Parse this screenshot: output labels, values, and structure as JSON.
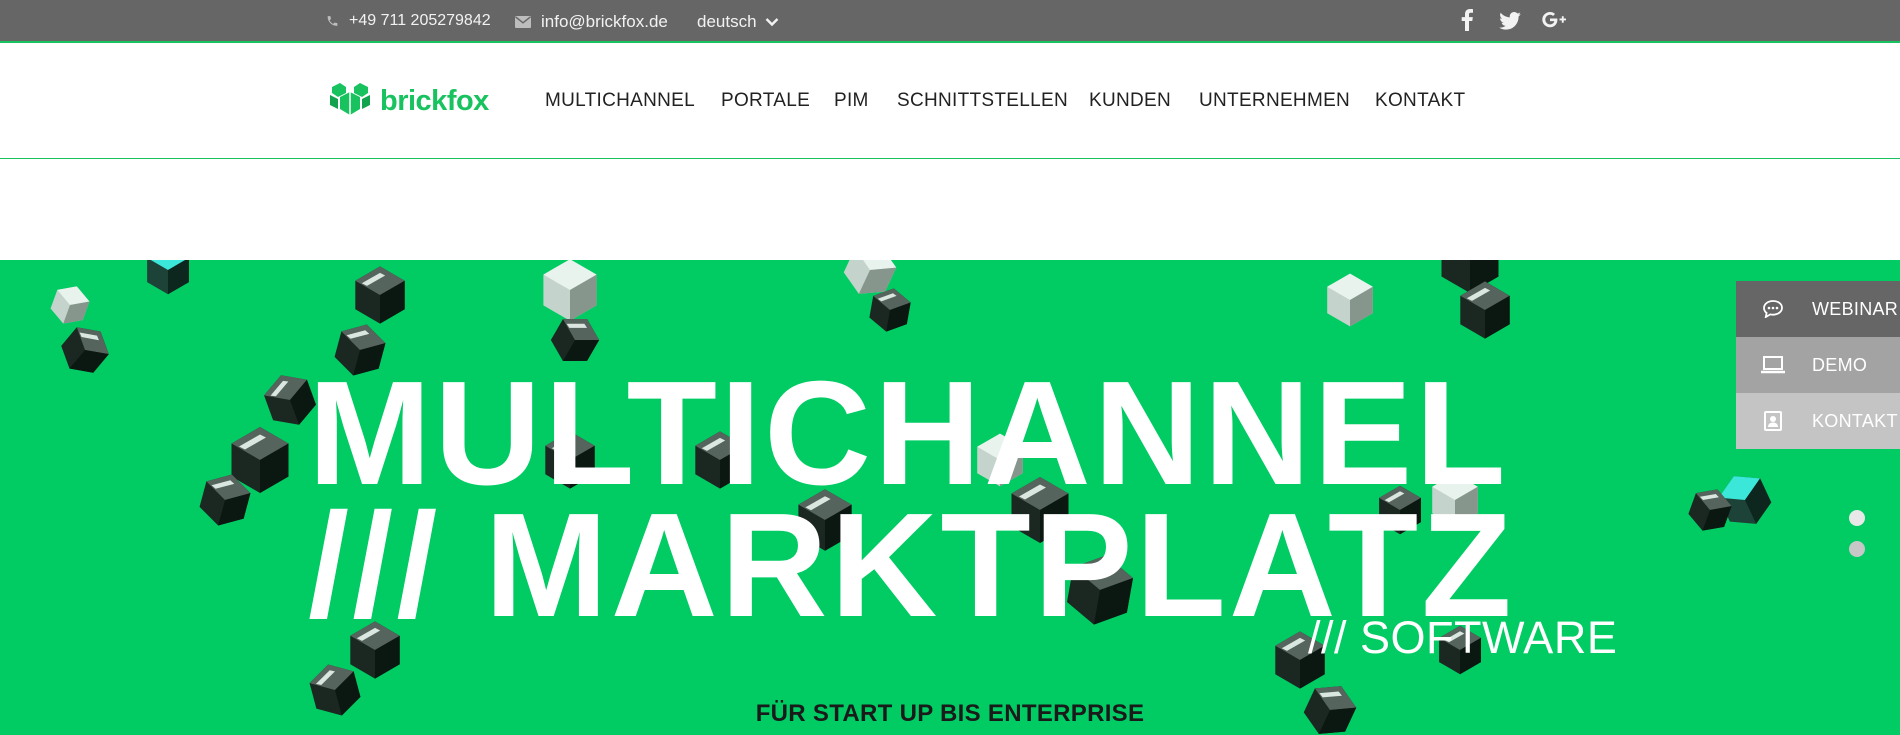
{
  "topbar": {
    "phone": "+49 711 205279842",
    "email": "info@brickfox.de",
    "language": "deutsch",
    "icons": [
      "phone-icon",
      "envelope-icon",
      "chevron-down-icon",
      "facebook-icon",
      "twitter-icon",
      "google-plus-icon"
    ]
  },
  "brand": {
    "name": "brickfox"
  },
  "nav": {
    "items": [
      "MULTICHANNEL",
      "PORTALE",
      "PIM",
      "SCHNITTSTELLEN",
      "KUNDEN",
      "UNTERNEHMEN",
      "KONTAKT"
    ]
  },
  "hero": {
    "line1": "MULTICHANNEL",
    "line2": "/// MARKTPLATZ",
    "line3": "/// SOFTWARE",
    "subtitle": "FÜR START UP BIS ENTERPRISE",
    "slides": 2,
    "active_slide": 1
  },
  "side_tabs": {
    "webinar": "WEBINAR",
    "demo": "DEMO",
    "kontakt": "KONTAKT"
  },
  "colors": {
    "brand_green": "#18c35f",
    "hero_green": "#00cc63",
    "topbar_gray": "#666666",
    "webinar_tab": "#666666",
    "demo_tab": "#a3a3a3",
    "kontakt_tab": "#c4c4c4"
  }
}
